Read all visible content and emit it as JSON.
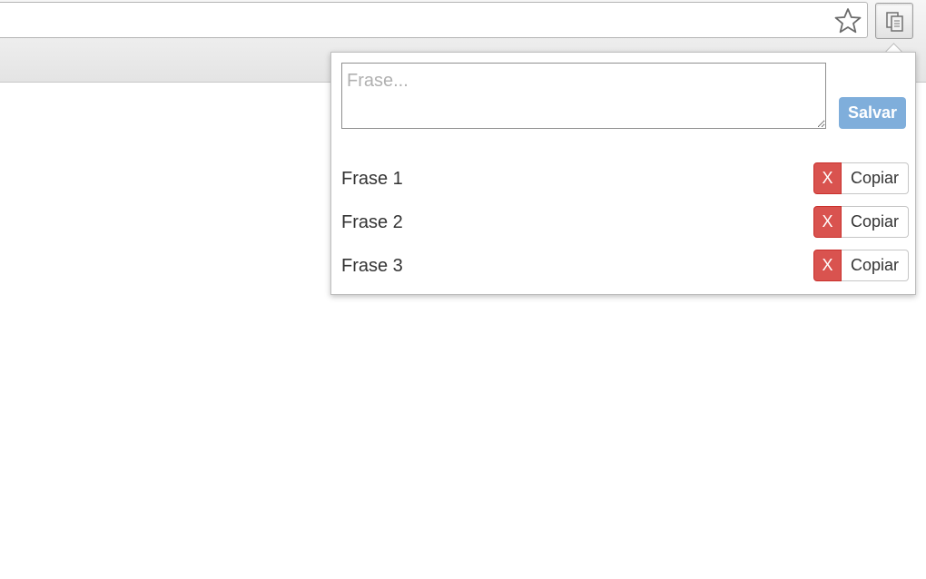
{
  "browser": {
    "star_icon": "star-outline-icon",
    "extension_icon": "clipboard-copy-icon"
  },
  "popup": {
    "input_placeholder": "Frase...",
    "input_value": "",
    "save_label": "Salvar",
    "phrases": [
      {
        "text": "Frase 1",
        "delete_label": "X",
        "copy_label": "Copiar"
      },
      {
        "text": "Frase 2",
        "delete_label": "X",
        "copy_label": "Copiar"
      },
      {
        "text": "Frase 3",
        "delete_label": "X",
        "copy_label": "Copiar"
      }
    ]
  },
  "colors": {
    "save_button": "#7faedb",
    "delete_button": "#d9534f"
  }
}
